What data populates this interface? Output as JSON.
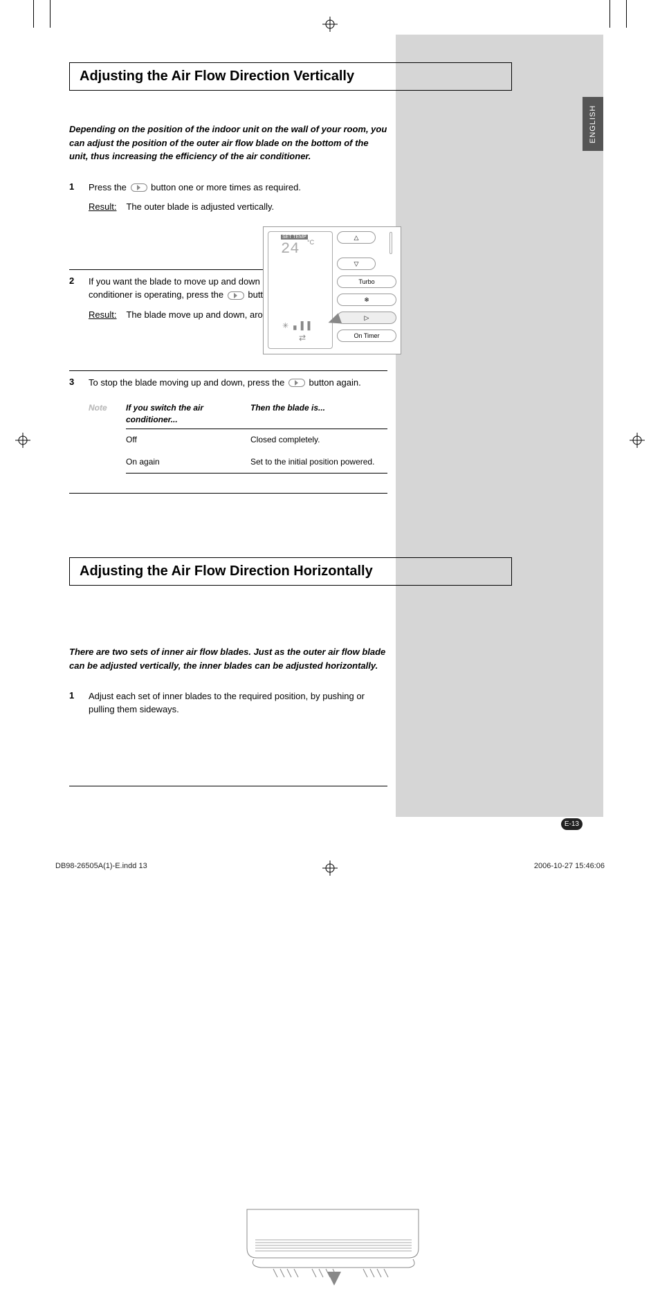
{
  "language_tab": "ENGLISH",
  "section1": {
    "heading": "Adjusting the Air Flow Direction Vertically",
    "intro": "Depending on the position of the indoor unit on the wall of your room, you can adjust the position of the outer air flow blade on the bottom of the unit, thus increasing the efficiency of the air conditioner.",
    "steps": [
      {
        "num": "1",
        "text_before": "Press the ",
        "text_after": " button one or more times as required.",
        "result_label": "Result:",
        "result_text": "The outer blade is adjusted vertically."
      },
      {
        "num": "2",
        "text_before": "If you want the blade to move up and down automatically when the air conditioner is operating, press the ",
        "text_after": " button.",
        "result_label": "Result:",
        "result_text": "The blade move up and down, around the base position set."
      },
      {
        "num": "3",
        "text_before": "To stop the blade moving up and down, press the ",
        "text_after": " button again.",
        "note_label": "Note",
        "note_table": {
          "head1": "If you switch the air conditioner...",
          "head2": "Then the blade is...",
          "rows": [
            {
              "c1": "Off",
              "c2": "Closed completely."
            },
            {
              "c1": "On again",
              "c2": "Set to the initial position powered."
            }
          ]
        }
      }
    ]
  },
  "section2": {
    "heading": "Adjusting the Air Flow Direction Horizontally",
    "intro": "There are two sets of inner air flow blades. Just as the outer air flow blade can be adjusted vertically, the inner blades can be adjusted horizontally.",
    "steps": [
      {
        "num": "1",
        "text": "Adjust each set of inner blades to the required position, by pushing or pulling them sideways."
      }
    ]
  },
  "remote": {
    "set_temp_label": "SET  TEMP",
    "temp_value": "24",
    "temp_unit": "°C",
    "btn_turbo": "Turbo",
    "btn_on_timer": "On Timer",
    "mini_icons": "✳ ▖▌▌",
    "mini_arrow": "⇄"
  },
  "page_number": "E-13",
  "footer_left": "DB98-26505A(1)-E.indd   13",
  "footer_right": "2006-10-27   15:46:06"
}
